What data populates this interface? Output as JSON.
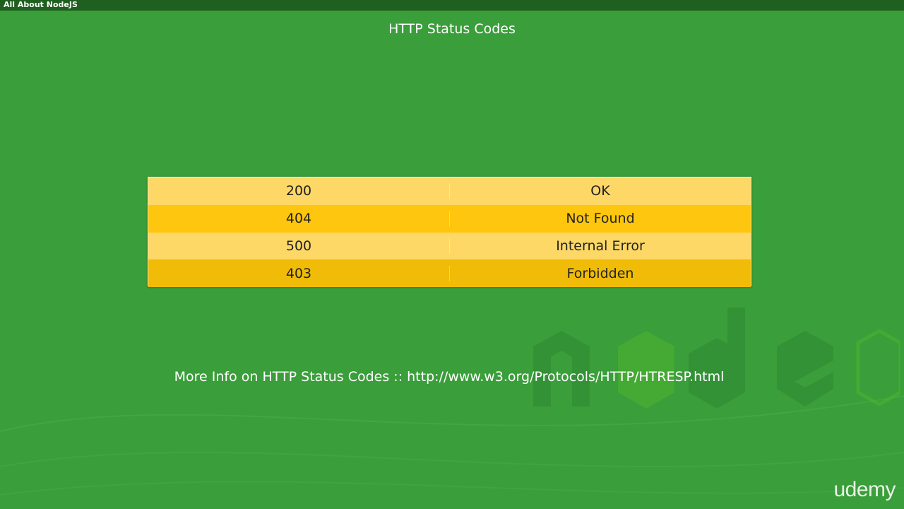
{
  "window": {
    "title": "All About NodeJS"
  },
  "slide": {
    "title": "HTTP Status Codes",
    "status_codes": [
      {
        "code": "200",
        "text": "OK"
      },
      {
        "code": "404",
        "text": "Not Found"
      },
      {
        "code": "500",
        "text": "Internal Error"
      },
      {
        "code": "403",
        "text": "Forbidden"
      }
    ],
    "info_line": "More Info on HTTP Status Codes :: http://www.w3.org/Protocols/HTTP/HTRESP.html"
  },
  "branding": {
    "udemy_label": "udemy"
  },
  "colors": {
    "background": "#3a9e3a",
    "titlebar": "#1f5f1f",
    "row_light": "#fdd866",
    "row_dark": "#fec60e",
    "row_dark_alt": "#f0bc08"
  }
}
